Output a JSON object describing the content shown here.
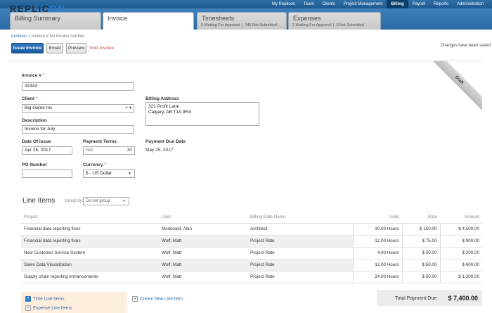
{
  "brand": {
    "logo_a": "REPLIC",
    "logo_b": "ON"
  },
  "nav": [
    "My Replicon",
    "Team",
    "Clients",
    "Project Management",
    "Billing",
    "Payroll",
    "Reports",
    "Administration"
  ],
  "nav_active": "Billing",
  "tabs": [
    {
      "label": "Billing Summary",
      "sub": []
    },
    {
      "label": "Invoice",
      "sub": []
    },
    {
      "label": "Timesheets",
      "sub": [
        "5 Waiting For Approval",
        "146 Not Submitted"
      ]
    },
    {
      "label": "Expenses",
      "sub": [
        "2 Waiting For Approval",
        "3 Not Submitted"
      ]
    }
  ],
  "breadcrumb": {
    "link": "Invoices",
    "sep": " > ",
    "current": "Invoice # No invoice number"
  },
  "actions": {
    "issue": "Issue Invoice",
    "email": "Email",
    "preview": "Preview",
    "void": "Void Invoice"
  },
  "status": {
    "saved": "Changes have been saved"
  },
  "draft_label": "Draft",
  "form": {
    "invoice_label": "Invoice #",
    "invoice_value": "34343",
    "client_label": "Client",
    "client_value": "Big Game Inc",
    "client_clear": "× ▾",
    "billing_address_label": "Billing Address",
    "billing_address_line1": "321 Profit Lane",
    "billing_address_line2": "Calgary, AB T1A 9R4",
    "description_label": "Description",
    "description_value": "Invoice for July",
    "date_issue_label": "Date Of Issue",
    "date_issue_value": "Apr 25, 2017",
    "payment_terms_label": "Payment Terms",
    "payment_terms_value": "Net",
    "payment_terms_days": "30",
    "payment_due_label": "Payment Due Date",
    "payment_due_value": "May 25, 2017",
    "po_label": "PO Number",
    "po_value": "",
    "currency_label": "Currency",
    "currency_value": "$ - US Dollar",
    "required_mark": "*"
  },
  "line_items": {
    "title": "Line Items",
    "group_by_label": "Group by:",
    "group_by_value": "Do not group",
    "columns": [
      "Project",
      "User",
      "Billing Rate Name",
      "Units",
      "Rate",
      "Amount"
    ],
    "rows": [
      [
        "Financial data reporting fixes",
        "Mcdonald, Alan",
        "Architect",
        "30.00 Hours",
        "$ 150.00",
        "$ 4,500.00"
      ],
      [
        "Financial data reporting fixes",
        "Wolf, Matt",
        "Project Rate",
        "12.00 Hours",
        "$ 75.00",
        "$ 900.00"
      ],
      [
        "New Customer Service System",
        "Wolf, Matt",
        "Project Rate",
        "4.00 Hours",
        "$ 50.00",
        "$ 200.00"
      ],
      [
        "Sales Data Visualization",
        "Wolf, Matt",
        "Project Rate",
        "12.00 Hours",
        "$ 50.00",
        "$ 600.00"
      ],
      [
        "Supply chain reporting enhancements",
        "Wolf, Matt",
        "Project Rate",
        "24.00 Hours",
        "$ 50.00",
        "$ 1,200.00"
      ]
    ],
    "add_time": "Time Line Items",
    "add_expense": "Expense Line Items",
    "create_new": "Create New Line Item",
    "total_label": "Total Payment Due",
    "total_value": "$ 7,400.00"
  }
}
